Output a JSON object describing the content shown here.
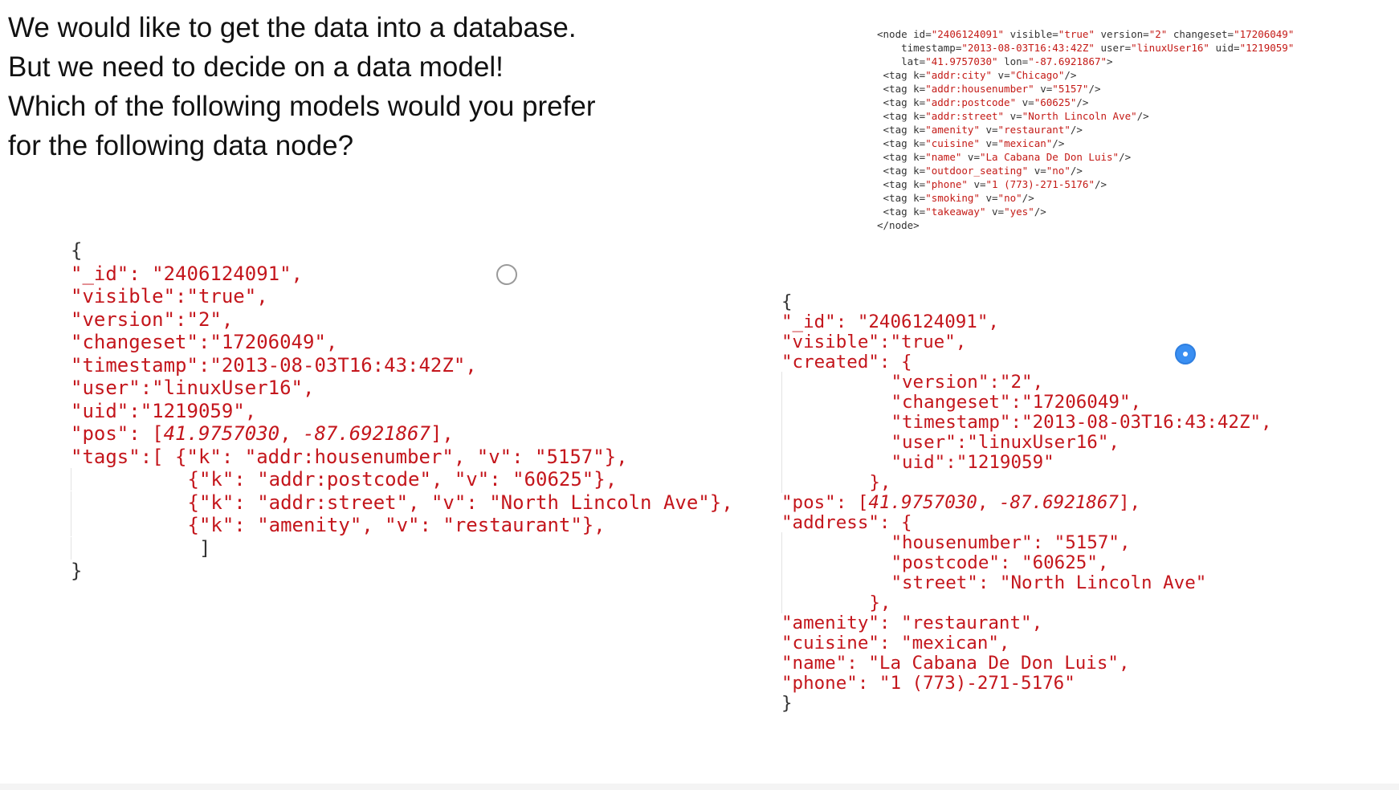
{
  "question": {
    "lines": [
      "We would like to get the data into a database.",
      "But we need to decide on a data model!",
      "Which of the following models would you prefer",
      "for the following data node?"
    ]
  },
  "xml_node": {
    "open": {
      "id": "2406124091",
      "visible": "true",
      "version": "2",
      "changeset": "17206049",
      "timestamp": "2013-08-03T16:43:42Z",
      "user": "linuxUser16",
      "uid": "1219059",
      "lat": "41.9757030",
      "lon": "-87.6921867"
    },
    "tags": [
      {
        "k": "addr:city",
        "v": "Chicago"
      },
      {
        "k": "addr:housenumber",
        "v": "5157"
      },
      {
        "k": "addr:postcode",
        "v": "60625"
      },
      {
        "k": "addr:street",
        "v": "North Lincoln Ave"
      },
      {
        "k": "amenity",
        "v": "restaurant"
      },
      {
        "k": "cuisine",
        "v": "mexican"
      },
      {
        "k": "name",
        "v": "La Cabana De Don Luis"
      },
      {
        "k": "outdoor_seating",
        "v": "no"
      },
      {
        "k": "phone",
        "v": "1 (773)-271-5176"
      },
      {
        "k": "smoking",
        "v": "no"
      },
      {
        "k": "takeaway",
        "v": "yes"
      }
    ],
    "close": "</node>"
  },
  "option_a": {
    "selected": false,
    "id": "2406124091",
    "visible": "true",
    "version": "2",
    "changeset": "17206049",
    "timestamp": "2013-08-03T16:43:42Z",
    "user": "linuxUser16",
    "uid": "1219059",
    "pos_lat": "41.9757030",
    "pos_lon": "-87.6921867",
    "tags": [
      {
        "k": "addr:housenumber",
        "v": "5157"
      },
      {
        "k": "addr:postcode",
        "v": "60625"
      },
      {
        "k": "addr:street",
        "v": "North Lincoln Ave"
      },
      {
        "k": "amenity",
        "v": "restaurant"
      }
    ]
  },
  "option_b": {
    "selected": true,
    "id": "2406124091",
    "visible": "true",
    "created": {
      "version": "2",
      "changeset": "17206049",
      "timestamp": "2013-08-03T16:43:42Z",
      "user": "linuxUser16",
      "uid": "1219059"
    },
    "pos_lat": "41.9757030",
    "pos_lon": "-87.6921867",
    "address": {
      "housenumber": "5157",
      "postcode": "60625",
      "street": "North Lincoln Ave"
    },
    "amenity": "restaurant",
    "cuisine": "mexican",
    "name": "La Cabana De Don Luis",
    "phone": "1 (773)-271-5176"
  }
}
